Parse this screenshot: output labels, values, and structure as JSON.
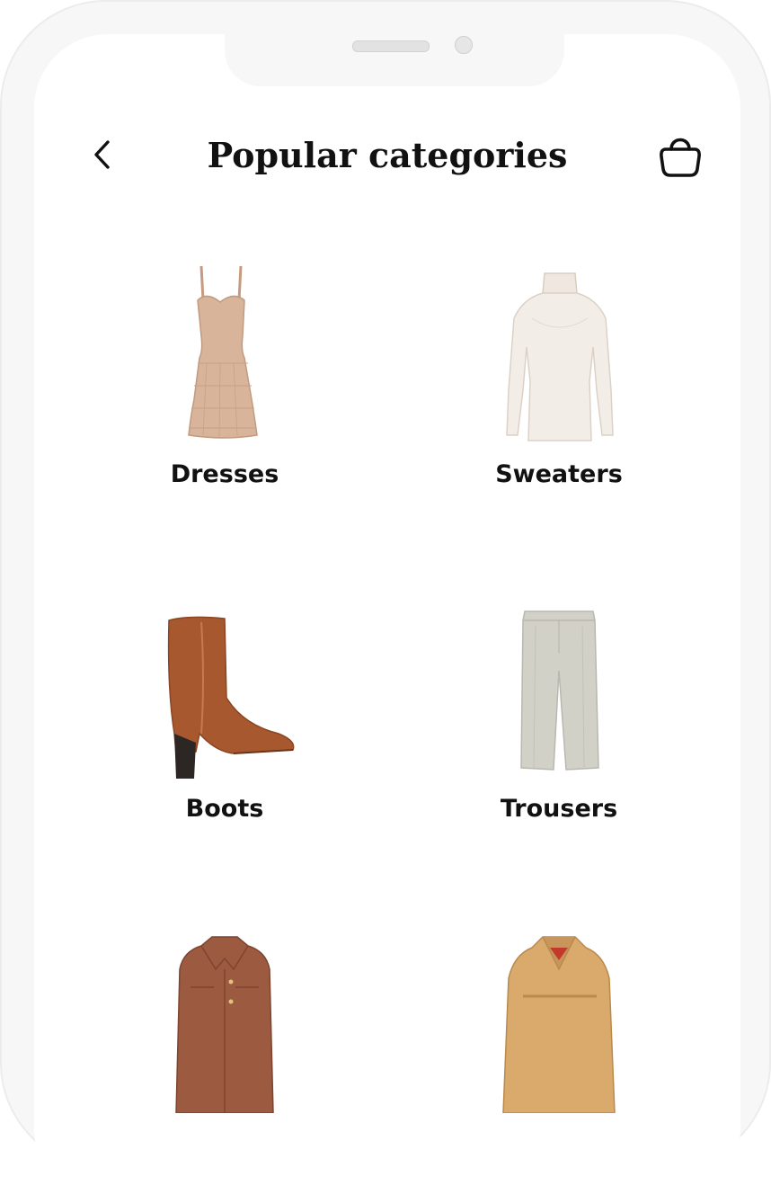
{
  "header": {
    "title": "Popular categories",
    "back_icon": "chevron-left-icon",
    "cart_icon": "shopping-bag-icon"
  },
  "categories": [
    {
      "label": "Dresses",
      "image": "dress-image",
      "color": "#d9b8a0"
    },
    {
      "label": "Sweaters",
      "image": "sweater-image",
      "color": "#f1ebe4"
    },
    {
      "label": "Boots",
      "image": "boot-image",
      "color": "#a65a35"
    },
    {
      "label": "Trousers",
      "image": "trousers-image",
      "color": "#d3d2c9"
    },
    {
      "label": "",
      "image": "jacket-image",
      "color": "#9c5a40"
    },
    {
      "label": "",
      "image": "coat-image",
      "color": "#d9aa6b"
    }
  ],
  "colors": {
    "text": "#111111",
    "background": "#ffffff",
    "bezel": "#f7f7f7"
  }
}
